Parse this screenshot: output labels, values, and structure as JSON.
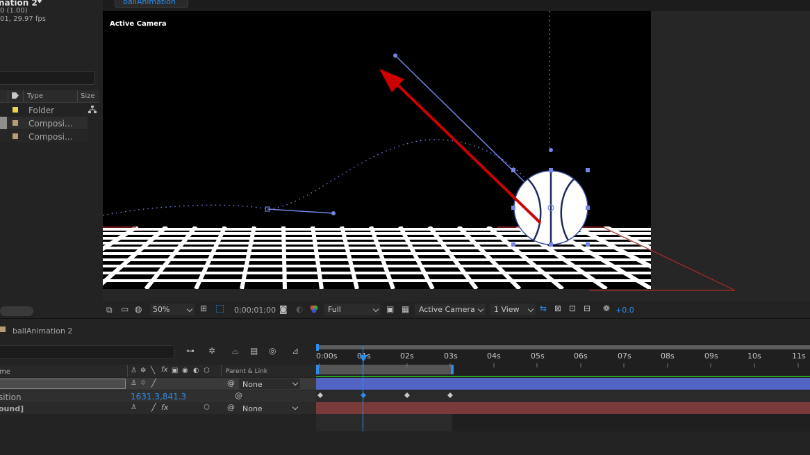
{
  "colors": {
    "accent_blue": "#2d8ceb",
    "red_arrow": "#cc0000",
    "path_blue": "#7585e6",
    "label_yellow": "#e8d25a",
    "label_tan": "#b59e76",
    "layer_bar_blue": "#5365c4",
    "layer_bar_red": "#7a3a3a"
  },
  "project": {
    "comp_name": "nation 2",
    "comp_info_1": "0 (1.00)",
    "comp_info_2": "01, 29.97 fps",
    "columns": {
      "type": "Type",
      "size": "Size"
    },
    "items": [
      {
        "type": "Folder"
      },
      {
        "type": "Composi..."
      },
      {
        "type": "Composi..."
      }
    ]
  },
  "viewer": {
    "tab_label": "ballAnimation",
    "camera_label": "Active Camera",
    "toolbar": {
      "zoom": "50%",
      "timecode": "0;00;01;00",
      "resolution": "Full",
      "view": "Active Camera",
      "layout": "1 View",
      "exposure": "+0.0"
    }
  },
  "timeline": {
    "comp_tab": "ballAnimation 2",
    "columns": {
      "name": "me",
      "parent": "Parent & Link"
    },
    "ruler": [
      "0:00s",
      "01s",
      "02s",
      "03s",
      "04s",
      "05s",
      "06s",
      "07s",
      "08s",
      "09s",
      "10s",
      "11s"
    ],
    "layers": [
      {
        "name": "",
        "parent": "None"
      },
      {
        "name": "sition",
        "value": "1631.3,841.3"
      },
      {
        "name": "ound]",
        "parent": "None"
      }
    ]
  }
}
